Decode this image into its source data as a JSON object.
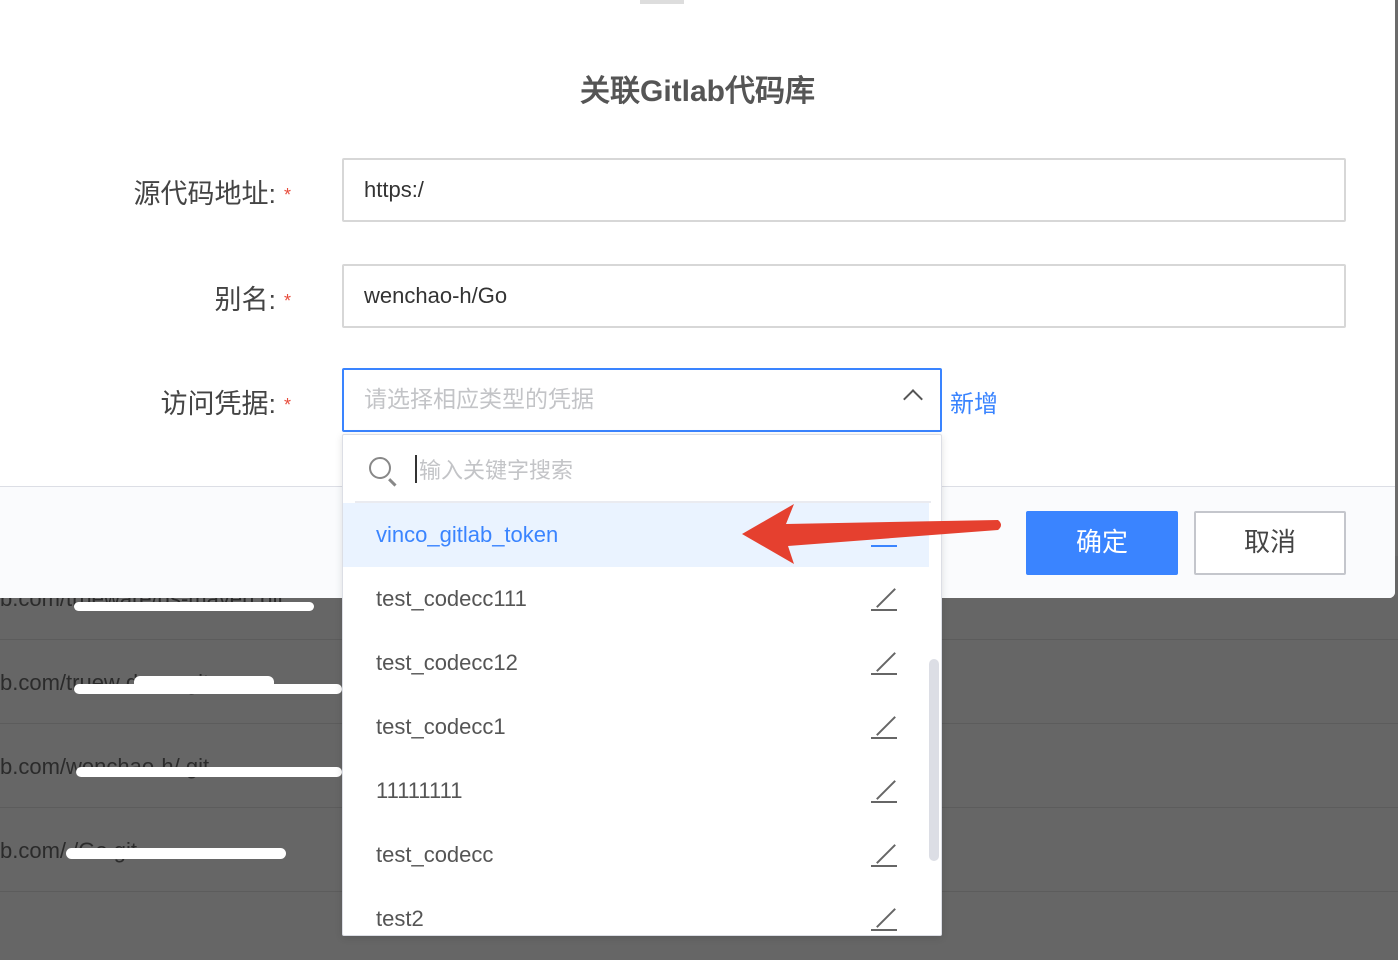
{
  "background_rows": [
    "b.com/trueware/ds-maven.git",
    "b.com/truew           ds       en.git",
    "b.com/wenchao-h/                      git",
    "b.com/               /Go.git"
  ],
  "dialog": {
    "title": "关联Gitlab代码库",
    "fields": {
      "source_label": "源代码地址:",
      "source_value": "https:/",
      "alias_label": "别名:",
      "alias_value": "wenchao-h/Go",
      "credential_label": "访问凭据:",
      "credential_placeholder": "请选择相应类型的凭据",
      "required_mark": "*"
    },
    "add_link": "新增",
    "confirm_button": "确定",
    "cancel_button": "取消"
  },
  "dropdown": {
    "search_placeholder": "输入关键字搜索",
    "items": [
      {
        "label": "vinco_gitlab_token",
        "active": true
      },
      {
        "label": "test_codecc111",
        "active": false
      },
      {
        "label": "test_codecc12",
        "active": false
      },
      {
        "label": "test_codecc1",
        "active": false
      },
      {
        "label": "11111111",
        "active": false
      },
      {
        "label": "test_codecc",
        "active": false
      },
      {
        "label": "test2",
        "active": false
      }
    ]
  },
  "colors": {
    "primary": "#3a84ff",
    "required": "#e74c3c",
    "annotation_arrow": "#e5402f"
  }
}
